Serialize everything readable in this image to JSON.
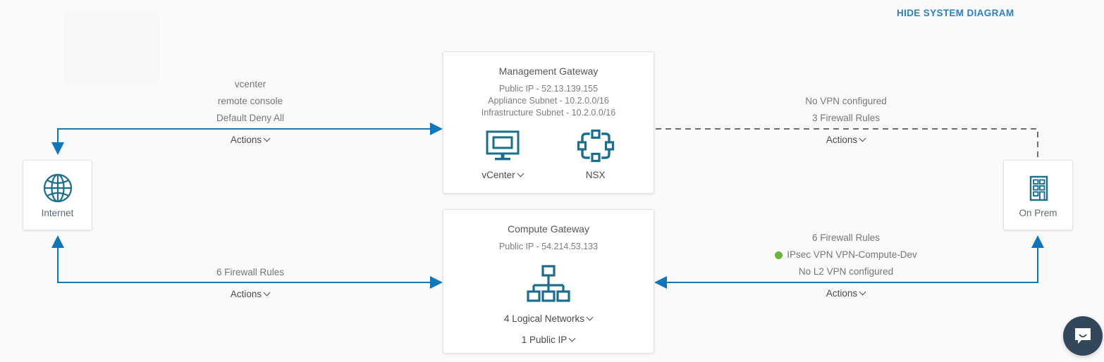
{
  "header": {
    "hide_diagram_label": "HIDE SYSTEM DIAGRAM"
  },
  "nodes": {
    "internet": {
      "label": "Internet",
      "icon": "globe-icon"
    },
    "on_prem": {
      "label": "On Prem",
      "icon": "building-icon"
    }
  },
  "management_gateway": {
    "title": "Management Gateway",
    "public_ip": "Public IP - 52.13.139.155",
    "appliance_subnet": "Appliance Subnet - 10.2.0.0/16",
    "infrastructure_subnet": "Infrastructure Subnet - 10.2.0.0/16",
    "vcenter_label": "vCenter",
    "nsx_label": "NSX"
  },
  "compute_gateway": {
    "title": "Compute Gateway",
    "public_ip": "Public IP - 54.214.53.133",
    "logical_networks_label": "4 Logical Networks",
    "public_ip_link_label": "1 Public IP"
  },
  "connections": {
    "mgw_internet": {
      "lines": [
        "vcenter",
        "remote console",
        "Default Deny All"
      ],
      "actions_label": "Actions",
      "line_style": "solid",
      "color": "#1175ba"
    },
    "cgw_internet": {
      "lines": [
        "6 Firewall Rules"
      ],
      "actions_label": "Actions",
      "line_style": "solid",
      "color": "#1175ba"
    },
    "mgw_onprem": {
      "lines": [
        "No VPN configured",
        "3 Firewall Rules"
      ],
      "actions_label": "Actions",
      "line_style": "dashed",
      "color": "#6e6e6e"
    },
    "cgw_onprem": {
      "lines": [
        "6 Firewall Rules",
        "IPsec VPN VPN-Compute-Dev",
        "No L2 VPN configured"
      ],
      "status_dot_color": "#6cb33f",
      "actions_label": "Actions",
      "line_style": "solid",
      "color": "#1175ba"
    }
  },
  "chat": {
    "icon": "chat-bubble-icon"
  },
  "theme": {
    "background": "#fafafa",
    "accent_blue": "#1175ba",
    "link_blue": "#2d7fc1",
    "icon_teal": "#1b6e8c",
    "status_green": "#6cb33f",
    "chat_navy": "#33475b"
  }
}
